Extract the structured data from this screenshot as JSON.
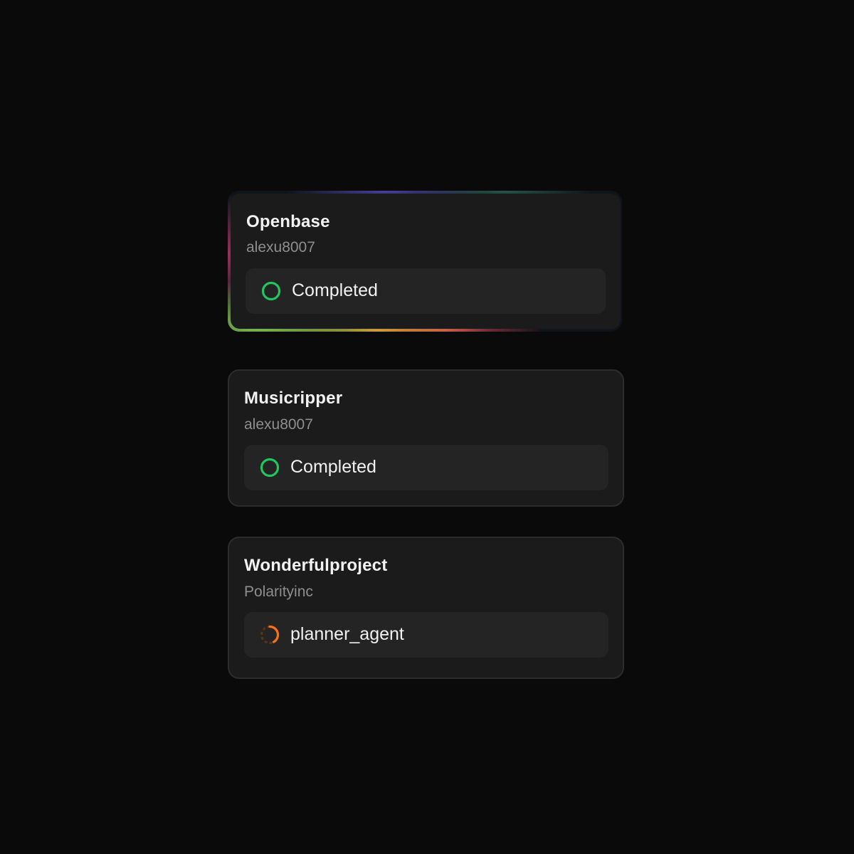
{
  "projects": [
    {
      "title": "Openbase",
      "owner": "alexu8007",
      "status": "Completed",
      "status_icon": "completed-circle-icon",
      "status_color": "#22c55e",
      "highlighted": true
    },
    {
      "title": "Musicripper",
      "owner": "alexu8007",
      "status": "Completed",
      "status_icon": "completed-circle-icon",
      "status_color": "#22c55e",
      "highlighted": false
    },
    {
      "title": "Wonderfulproject",
      "owner": "Polarityinc",
      "status": "planner_agent",
      "status_icon": "loading-spinner-icon",
      "status_color": "#f97316",
      "highlighted": false
    }
  ],
  "colors": {
    "background": "#0a0a0a",
    "card": "#1b1b1b",
    "card_border": "#2c2c2c",
    "pill": "#242424",
    "title_text": "#f2f2f2",
    "owner_text": "#8e8e8e",
    "success": "#22c55e",
    "in_progress": "#f97316"
  }
}
